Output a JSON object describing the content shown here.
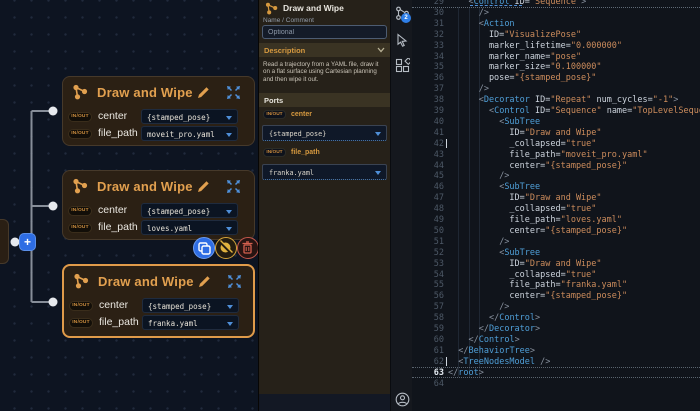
{
  "canvas": {
    "nodes": [
      {
        "title": "Draw and Wipe",
        "selected": false,
        "ports": [
          {
            "dir": "IN/OUT",
            "name": "center",
            "value": "{stamped_pose}"
          },
          {
            "dir": "IN/OUT",
            "name": "file_path",
            "value": "moveit_pro.yaml"
          }
        ]
      },
      {
        "title": "Draw and Wipe",
        "selected": false,
        "ports": [
          {
            "dir": "IN/OUT",
            "name": "center",
            "value": "{stamped_pose}"
          },
          {
            "dir": "IN/OUT",
            "name": "file_path",
            "value": "loves.yaml"
          }
        ]
      },
      {
        "title": "Draw and Wipe",
        "selected": true,
        "ports": [
          {
            "dir": "IN/OUT",
            "name": "center",
            "value": "{stamped_pose}"
          },
          {
            "dir": "IN/OUT",
            "name": "file_path",
            "value": "franka.yaml"
          }
        ]
      }
    ],
    "add_button_label": "+"
  },
  "inspector": {
    "title": "Draw and Wipe",
    "name_comment_label": "Name / Comment",
    "name_input_value": "",
    "name_input_placeholder": "Optional",
    "description_header": "Description",
    "description_text": "Read a trajectory from a YAML file, draw it on a flat surface using Cartesian planning and then wipe it out.",
    "ports_header": "Ports",
    "ports": [
      {
        "dir": "IN/OUT",
        "name": "center",
        "value": "{stamped_pose}"
      },
      {
        "dir": "IN/OUT",
        "name": "file_path",
        "value": "franka.yaml"
      }
    ]
  },
  "rail": {
    "tree_view_badge": "2"
  },
  "editor": {
    "current_line": 63,
    "cursor_lines": [
      42,
      62
    ],
    "lines": [
      {
        "n": 29,
        "t": "    <Control ID=\"Sequence\">"
      },
      {
        "n": 30,
        "t": "      />"
      },
      {
        "n": 31,
        "t": "      <Action"
      },
      {
        "n": 32,
        "t": "        ID=\"VisualizePose\""
      },
      {
        "n": 33,
        "t": "        marker_lifetime=\"0.000000\""
      },
      {
        "n": 34,
        "t": "        marker_name=\"pose\""
      },
      {
        "n": 35,
        "t": "        marker_size=\"0.100000\""
      },
      {
        "n": 36,
        "t": "        pose=\"{stamped_pose}\""
      },
      {
        "n": 37,
        "t": "      />"
      },
      {
        "n": 38,
        "t": "      <Decorator ID=\"Repeat\" num_cycles=\"-1\">"
      },
      {
        "n": 39,
        "t": "        <Control ID=\"Sequence\" name=\"TopLevelSequence\">"
      },
      {
        "n": 40,
        "t": "          <SubTree"
      },
      {
        "n": 41,
        "t": "            ID=\"Draw and Wipe\""
      },
      {
        "n": 42,
        "t": "            _collapsed=\"true\""
      },
      {
        "n": 43,
        "t": "            file_path=\"moveit_pro.yaml\""
      },
      {
        "n": 44,
        "t": "            center=\"{stamped_pose}\""
      },
      {
        "n": 45,
        "t": "          />"
      },
      {
        "n": 46,
        "t": "          <SubTree"
      },
      {
        "n": 47,
        "t": "            ID=\"Draw and Wipe\""
      },
      {
        "n": 48,
        "t": "            _collapsed=\"true\""
      },
      {
        "n": 49,
        "t": "            file_path=\"loves.yaml\""
      },
      {
        "n": 50,
        "t": "            center=\"{stamped_pose}\""
      },
      {
        "n": 51,
        "t": "          />"
      },
      {
        "n": 52,
        "t": "          <SubTree"
      },
      {
        "n": 53,
        "t": "            ID=\"Draw and Wipe\""
      },
      {
        "n": 54,
        "t": "            _collapsed=\"true\""
      },
      {
        "n": 55,
        "t": "            file_path=\"franka.yaml\""
      },
      {
        "n": 56,
        "t": "            center=\"{stamped_pose}\""
      },
      {
        "n": 57,
        "t": "          />"
      },
      {
        "n": 58,
        "t": "        </Control>"
      },
      {
        "n": 59,
        "t": "      </Decorator>"
      },
      {
        "n": 60,
        "t": "    </Control>"
      },
      {
        "n": 61,
        "t": "  </BehaviorTree>"
      },
      {
        "n": 62,
        "t": "  <TreeNodesModel />"
      },
      {
        "n": 63,
        "t": "</root>"
      },
      {
        "n": 64,
        "t": ""
      }
    ]
  },
  "colors": {
    "accent_orange": "#e2a04f",
    "accent_blue": "#4f8fd8",
    "node_bg": "#2b2014",
    "selected_border": "#e09b4a",
    "xml_tag": "#4f9fd8",
    "xml_string": "#cc8c5c"
  }
}
